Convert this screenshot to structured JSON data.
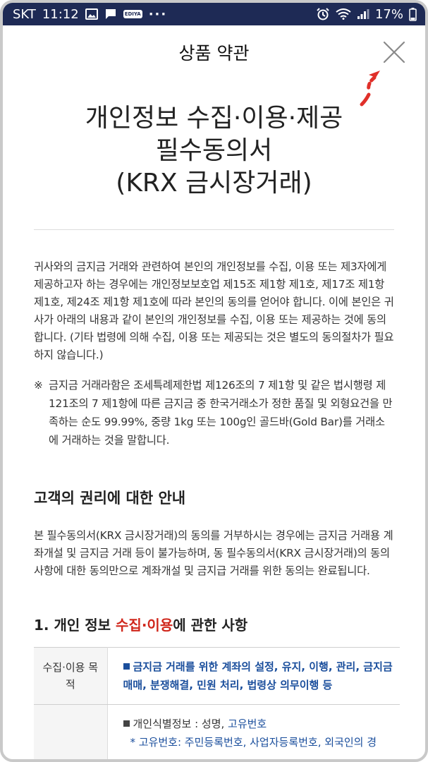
{
  "status": {
    "carrier": "SKT",
    "time": "11:12",
    "ediya": "EDIYA",
    "more": "···",
    "battery": "17%"
  },
  "header": {
    "title": "상품 약관"
  },
  "doc": {
    "title_line1": "개인정보 수집·이용·제공",
    "title_line2": "필수동의서",
    "title_line3": "(KRX 금시장거래)",
    "intro": "귀사와의 금지금 거래와 관련하여 본인의 개인정보를 수집, 이용 또는 제3자에게 제공하고자 하는 경우에는 개인정보보호업 제15조 제1항 제1호, 제17조 제1항 제1호, 제24조 제1항 제1호에 따라 본인의 동의를 얻어야 합니다. 이에 본인은 귀사가 아래의 내용과 같이 본인의 개인정보를 수집, 이용 또는 제공하는 것에 동의합니다. (기타 법령에 의해 수집, 이용 또는 제공되는 것은 별도의 동의절차가 필요하지 않습니다.)",
    "note_mark": "※",
    "note": "금지금 거래라함은 조세특례제한법 제126조의 7 제1항 및 같은 법시행령 제121조의 7 제1항에 따른 금지금 중 한국거래소가 정한 품질 및 외형요건을 만족하는 순도 99.99%, 중량 1kg 또는 100g인 골드바(Gold Bar)를 거래소에 거래하는 것을 말합니다."
  },
  "rights": {
    "heading": "고객의 권리에 대한 안내",
    "body": "본 필수동의서(KRX 금시장거래)의 동의를 거부하시는 경우에는 금지금 거래용 계좌개설 및 금지금 거래 등이 불가능하며, 동 필수동의서(KRX 금시장거래)의 동의사항에 대한 동의만으로 계좌개설 및 금지급 거래를 위한 동의는 완료됩니다."
  },
  "section1": {
    "heading_prefix": "1. 개인 정보 ",
    "heading_highlight": "수집·이용",
    "heading_suffix": "에 관한 사항",
    "row1_label": "수집·이용 목적",
    "row1_value": "금지금 거래를 위한 계좌의 설정, 유지, 이행, 관리, 금지금 매매, 분쟁해결, 민원 처리, 법령상 의무이행 등",
    "row2_label": "",
    "row2_value_prefix": "개인식별정보 : 성명, ",
    "row2_value_highlight": "고유번호",
    "row2_value_cut": "* 고유번호: 주민등록번호, 사업자등록번호, 외국인의 경"
  },
  "colors": {
    "statusbar": "#1e2a55",
    "accent_red": "#d0271c",
    "accent_blue": "#1a4e9c"
  },
  "icons": [
    "image-icon",
    "message-icon",
    "ediya-icon",
    "alarm-icon",
    "wifi-icon",
    "signal-icon",
    "battery-icon",
    "close-icon",
    "hint-arrow-icon"
  ]
}
